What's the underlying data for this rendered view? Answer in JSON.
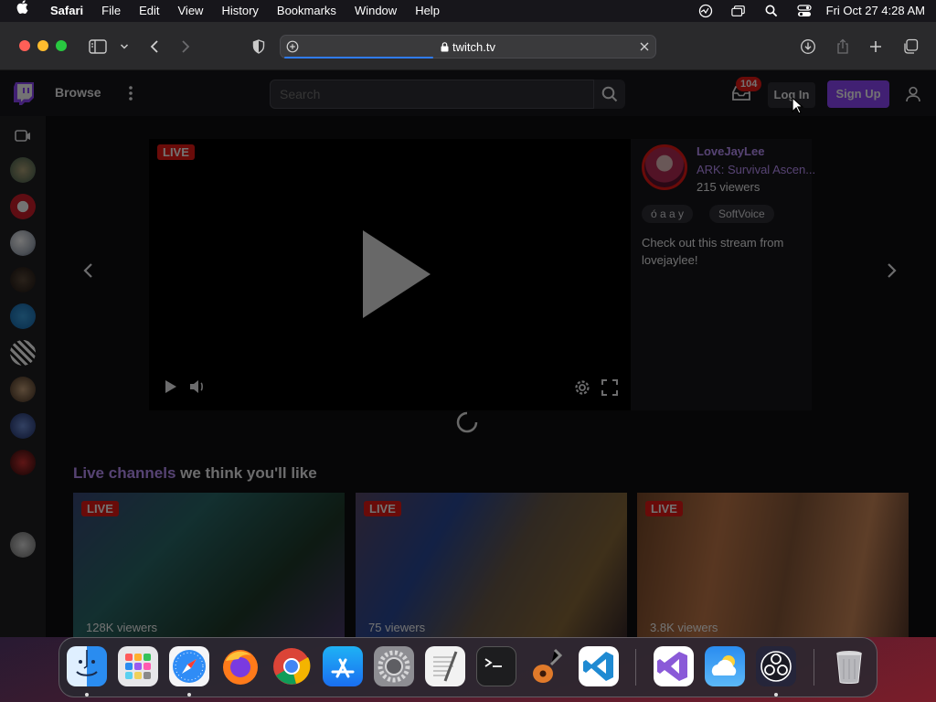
{
  "menubar": {
    "app_name": "Safari",
    "menus": [
      "File",
      "Edit",
      "View",
      "History",
      "Bookmarks",
      "Window",
      "Help"
    ],
    "clock": "Fri Oct 27  4:28 AM"
  },
  "browser": {
    "url": "twitch.tv",
    "load_progress": 0.4
  },
  "twitch": {
    "browse_label": "Browse",
    "search_placeholder": "Search",
    "notification_count": "104",
    "login_label": "Log In",
    "signup_label": "Sign Up",
    "featured": {
      "live_label": "LIVE",
      "channel_name": "LoveJayLee",
      "game": "ARK: Survival Ascen...",
      "viewers": "215 viewers",
      "tags": [
        "ó a a y",
        "SoftVoice"
      ],
      "description": "Check out this stream from lovejaylee!"
    },
    "section_title_highlight": "Live channels",
    "section_title_rest": " we think you'll like",
    "cards": [
      {
        "live_label": "LIVE",
        "viewers": "128K viewers"
      },
      {
        "live_label": "LIVE",
        "viewers": "75 viewers"
      },
      {
        "live_label": "LIVE",
        "viewers": "3.8K viewers"
      }
    ]
  },
  "colors": {
    "twitch_purple": "#9147ff",
    "live_red": "#e91916",
    "safari_accent": "#2f7cf6"
  },
  "dock": {
    "apps": [
      "Finder",
      "Launchpad",
      "Safari",
      "Firefox",
      "Google Chrome",
      "App Store",
      "System Settings",
      "TextEdit",
      "Terminal",
      "GarageBand",
      "Visual Studio Code",
      "Visual Studio",
      "Weather",
      "OBS",
      "Trash"
    ]
  }
}
